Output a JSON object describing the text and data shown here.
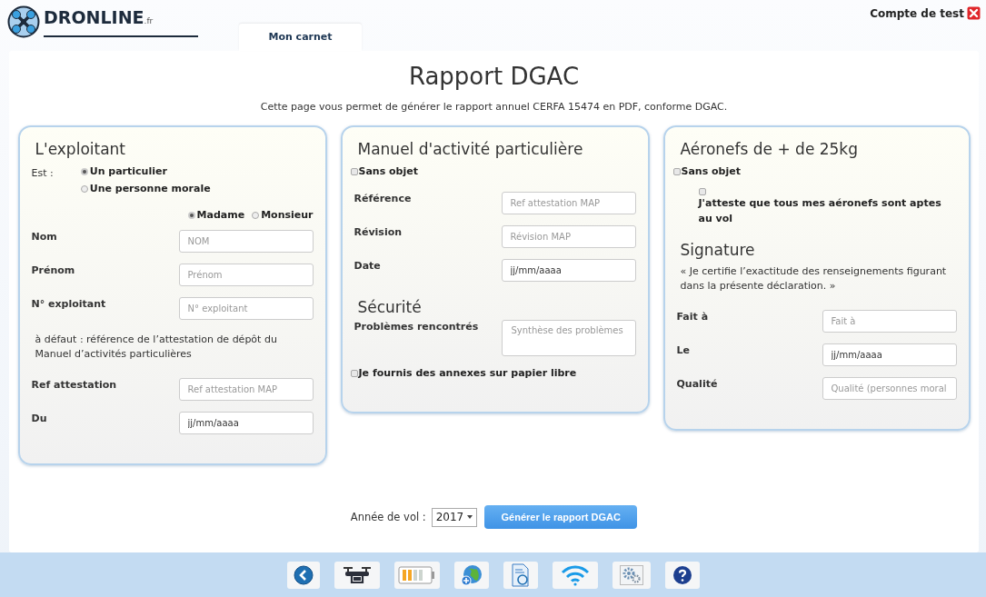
{
  "header": {
    "logo": "DRONLINE",
    "logo_suffix": ".fr",
    "account": "Compte de test"
  },
  "tabs": [
    {
      "label": "Mon carnet",
      "selected": true
    }
  ],
  "page": {
    "title": "Rapport DGAC",
    "intro": "Cette page vous permet de générer le rapport annuel CERFA 15474 en PDF, conforme DGAC."
  },
  "panels": [
    {
      "title": "L'exploitant",
      "rows": [
        {
          "kind": "radio_stack",
          "label": "Est :",
          "options": [
            {
              "label": "Un particulier",
              "selected": true
            },
            {
              "label": "Une personne morale",
              "selected": false
            }
          ]
        },
        {
          "kind": "radio_inline",
          "options": [
            {
              "label": "Madame",
              "selected": true
            },
            {
              "label": "Monsieur",
              "selected": false
            }
          ]
        },
        {
          "kind": "field",
          "label": "Nom",
          "placeholder": "NOM"
        },
        {
          "kind": "field",
          "label": "Prénom",
          "placeholder": "Prénom"
        },
        {
          "kind": "field",
          "label": "N° exploitant",
          "placeholder": "N° exploitant"
        },
        {
          "kind": "note",
          "text": "à défaut : référence de l’attestation de dépôt du Manuel d’activités particulières"
        },
        {
          "kind": "field",
          "label": "Ref attestation",
          "placeholder": "Ref attestation MAP"
        },
        {
          "kind": "field",
          "label": "Du",
          "value": "jj/mm/aaaa"
        }
      ]
    },
    {
      "title": "Manuel d'activité particulière",
      "rows": [
        {
          "kind": "checkbox",
          "label": "Sans objet",
          "checked": false
        },
        {
          "kind": "field",
          "label": "Référence",
          "placeholder": "Ref attestation MAP"
        },
        {
          "kind": "field",
          "label": "Révision",
          "placeholder": "Révision MAP"
        },
        {
          "kind": "field",
          "label": "Date",
          "value": "jj/mm/aaaa"
        },
        {
          "kind": "heading",
          "text": "Sécurité"
        },
        {
          "kind": "textarea",
          "label": "Problèmes rencontrés",
          "placeholder": "Synthèse des problèmes"
        },
        {
          "kind": "checkbox",
          "label": "Je fournis des annexes sur papier libre",
          "checked": false
        }
      ]
    },
    {
      "title": "Aéronefs de + de 25kg",
      "rows": [
        {
          "kind": "checkbox",
          "label": "Sans objet",
          "checked": false
        },
        {
          "kind": "checkbox_stacked",
          "label": "J'atteste que tous mes aéronefs sont aptes au vol",
          "checked": false
        },
        {
          "kind": "heading",
          "text": "Signature"
        },
        {
          "kind": "note",
          "text": "« Je certifie l’exactitude des renseignements figurant dans la présente déclaration. »"
        },
        {
          "kind": "field",
          "label": "Fait à",
          "placeholder": "Fait à"
        },
        {
          "kind": "field",
          "label": "Le",
          "value": "jj/mm/aaaa"
        },
        {
          "kind": "field",
          "label": "Qualité",
          "placeholder": "Qualité (personnes moral"
        }
      ]
    }
  ],
  "footer": {
    "year_label": "Année de vol :",
    "year": "2017",
    "button": "Générer le rapport DGAC"
  }
}
